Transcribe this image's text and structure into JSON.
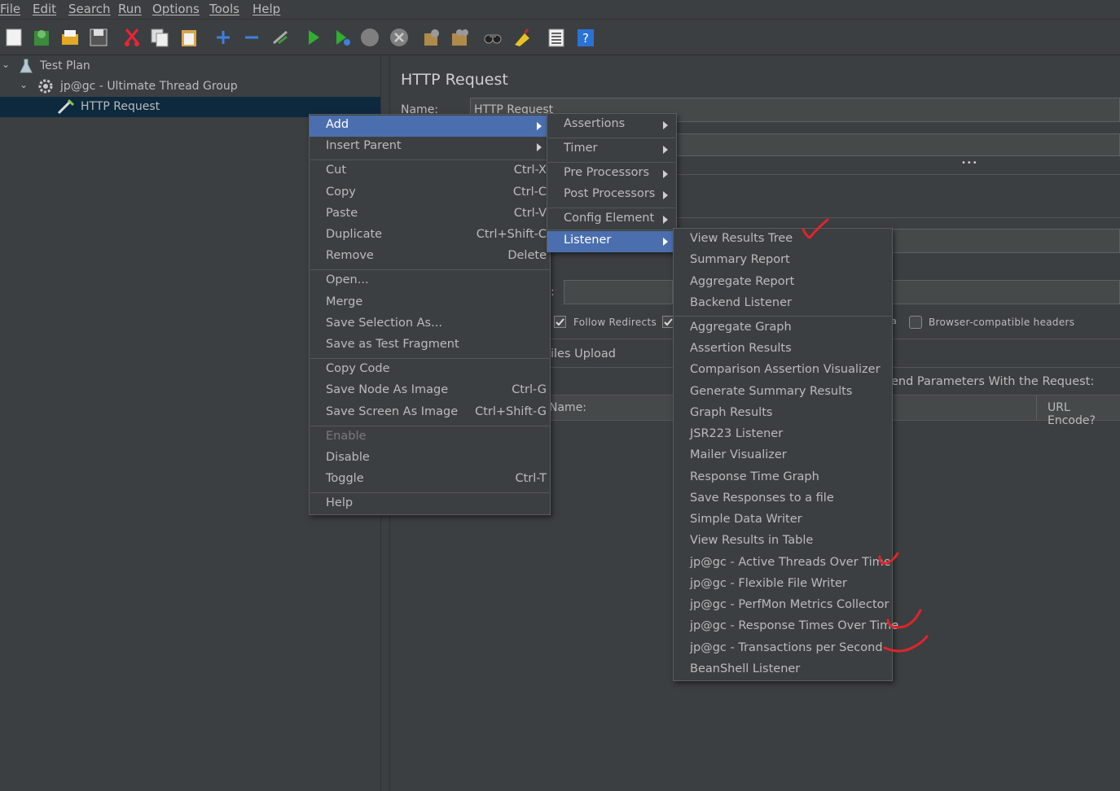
{
  "menubar": [
    "File",
    "Edit",
    "Search",
    "Run",
    "Options",
    "Tools",
    "Help"
  ],
  "toolbar_icons": [
    "new-icon",
    "templates-icon",
    "open-icon",
    "save-icon",
    "cut-icon",
    "copy-icon",
    "paste-icon",
    "expand-icon",
    "collapse-icon",
    "toggle-icon",
    "start-icon",
    "start-no-pause-icon",
    "stop-icon",
    "shutdown-icon",
    "clear-icon",
    "clear-all-icon",
    "search-icon",
    "reset-search-icon",
    "function-helper-icon",
    "help-icon"
  ],
  "tree": {
    "items": [
      {
        "label": "Test Plan"
      },
      {
        "label": "jp@gc - Ultimate Thread Group"
      },
      {
        "label": "HTTP Request"
      }
    ]
  },
  "panel": {
    "title": "HTTP Request",
    "name_label": "Name:",
    "name_value": "HTTP Request",
    "follow_redirects": "Follow Redirects",
    "browser_headers": "Browser-compatible headers",
    "files_upload": "iles Upload",
    "send_params": "end Parameters With the Request:",
    "col_name": "Name:",
    "col_url_encode": "URL Encode?",
    "ellipsis": "•••",
    "partial_colon": ":",
    "partial_a": "a"
  },
  "context_menu": {
    "items": [
      {
        "label": "Add",
        "accel": "",
        "submenu": true,
        "highlight": true
      },
      {
        "label": "Insert Parent",
        "accel": "",
        "submenu": true
      },
      {
        "label": "Cut",
        "accel": "Ctrl-X"
      },
      {
        "label": "Copy",
        "accel": "Ctrl-C"
      },
      {
        "label": "Paste",
        "accel": "Ctrl-V"
      },
      {
        "label": "Duplicate",
        "accel": "Ctrl+Shift-C"
      },
      {
        "label": "Remove",
        "accel": "Delete"
      },
      {
        "label": "Open...",
        "accel": ""
      },
      {
        "label": "Merge",
        "accel": ""
      },
      {
        "label": "Save Selection As...",
        "accel": ""
      },
      {
        "label": "Save as Test Fragment",
        "accel": ""
      },
      {
        "label": "Copy Code",
        "accel": ""
      },
      {
        "label": "Save Node As Image",
        "accel": "Ctrl-G"
      },
      {
        "label": "Save Screen As Image",
        "accel": "Ctrl+Shift-G"
      },
      {
        "label": "Enable",
        "accel": "",
        "disabled": true
      },
      {
        "label": "Disable",
        "accel": ""
      },
      {
        "label": "Toggle",
        "accel": "Ctrl-T"
      },
      {
        "label": "Help",
        "accel": ""
      }
    ]
  },
  "add_menu": {
    "items": [
      {
        "label": "Assertions"
      },
      {
        "label": "Timer"
      },
      {
        "label": "Pre Processors"
      },
      {
        "label": "Post Processors"
      },
      {
        "label": "Config Element"
      },
      {
        "label": "Listener",
        "highlight": true
      }
    ]
  },
  "listener_menu": {
    "items": [
      {
        "label": "View Results Tree"
      },
      {
        "label": "Summary Report"
      },
      {
        "label": "Aggregate Report"
      },
      {
        "label": "Backend Listener"
      },
      {
        "label": "Aggregate Graph"
      },
      {
        "label": "Assertion Results"
      },
      {
        "label": "Comparison Assertion Visualizer"
      },
      {
        "label": "Generate Summary Results"
      },
      {
        "label": "Graph Results"
      },
      {
        "label": "JSR223 Listener"
      },
      {
        "label": "Mailer Visualizer"
      },
      {
        "label": "Response Time Graph"
      },
      {
        "label": "Save Responses to a file"
      },
      {
        "label": "Simple Data Writer"
      },
      {
        "label": "View Results in Table"
      },
      {
        "label": "jp@gc - Active Threads Over Time"
      },
      {
        "label": "jp@gc - Flexible File Writer"
      },
      {
        "label": "jp@gc - PerfMon Metrics Collector"
      },
      {
        "label": "jp@gc - Response Times Over Time"
      },
      {
        "label": "jp@gc - Transactions per Second"
      },
      {
        "label": "BeanShell Listener"
      }
    ]
  },
  "colors": {
    "background": "#3c3f41",
    "highlight": "#4b6eaf",
    "tree_selection": "#0d293e",
    "annotation": "#e0242c"
  }
}
